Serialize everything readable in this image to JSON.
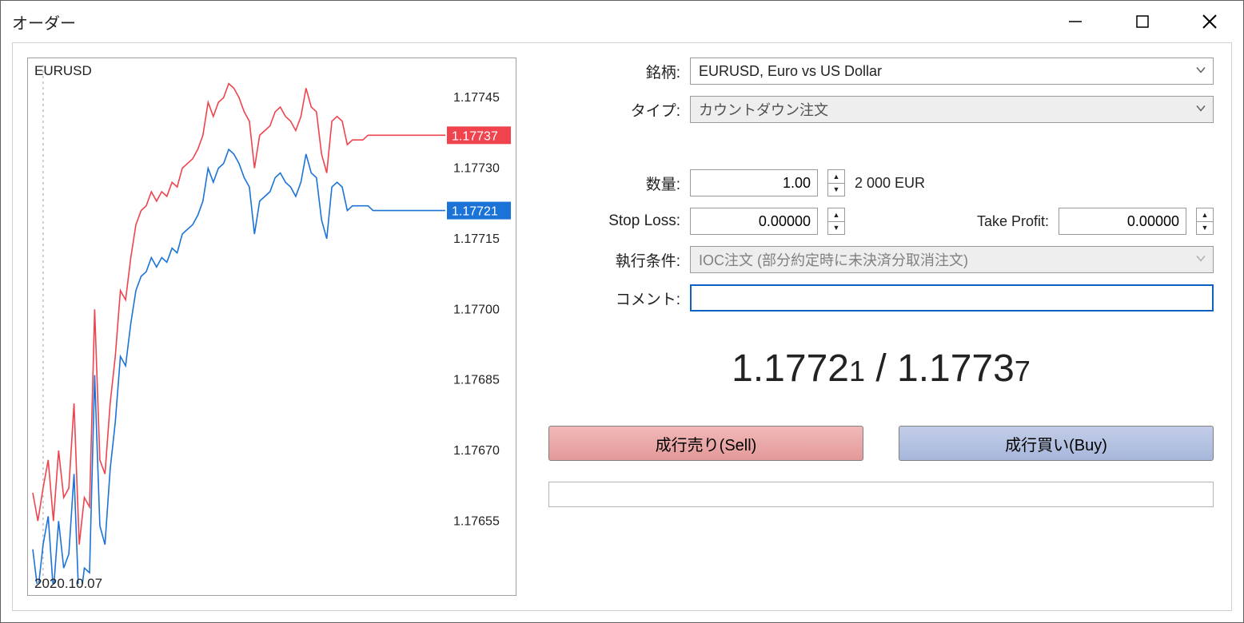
{
  "window": {
    "title": "オーダー"
  },
  "chart": {
    "symbol": "EURUSD",
    "date_label": "2020.10.07",
    "ask_tag": "1.17737",
    "bid_tag": "1.17721",
    "yticks": [
      "1.17745",
      "1.17730",
      "1.17715",
      "1.17700",
      "1.17685",
      "1.17670",
      "1.17655"
    ]
  },
  "form": {
    "symbol_label": "銘柄:",
    "symbol_value": "EURUSD, Euro vs US Dollar",
    "type_label": "タイプ:",
    "type_value": "カウントダウン注文",
    "volume_label": "数量:",
    "volume_value": "1.00",
    "volume_units": "2 000 EUR",
    "sl_label": "Stop Loss:",
    "sl_value": "0.00000",
    "tp_label": "Take Profit:",
    "tp_value": "0.00000",
    "fill_label": "執行条件:",
    "fill_value": "IOC注文 (部分約定時に未決済分取消注文)",
    "comment_label": "コメント:",
    "comment_value": ""
  },
  "quote": {
    "bid_main": "1.1772",
    "bid_last": "1",
    "sep": " / ",
    "ask_main": "1.1773",
    "ask_last": "7"
  },
  "buttons": {
    "sell": "成行売り(Sell)",
    "buy": "成行買い(Buy)"
  },
  "chart_data": {
    "type": "line",
    "x": [
      0,
      1,
      2,
      3,
      4,
      5,
      6,
      7,
      8,
      9,
      10,
      11,
      12,
      13,
      14,
      15,
      16,
      17,
      18,
      19,
      20,
      21,
      22,
      23,
      24,
      25,
      26,
      27,
      28,
      29,
      30,
      31,
      32,
      33,
      34,
      35,
      36,
      37,
      38,
      39,
      40,
      41,
      42,
      43,
      44,
      45,
      46,
      47,
      48,
      49,
      50,
      51,
      52,
      53,
      54,
      55,
      56,
      57,
      58,
      59,
      60,
      61,
      62,
      63,
      64,
      65,
      66,
      67,
      68,
      69,
      70,
      71,
      72,
      73,
      74,
      75,
      76,
      77,
      78,
      79,
      80
    ],
    "series": [
      {
        "name": "ask",
        "color": "#ef434e",
        "values": [
          1.17661,
          1.17655,
          1.17662,
          1.17668,
          1.17655,
          1.1767,
          1.1766,
          1.17662,
          1.1768,
          1.1765,
          1.1766,
          1.17658,
          1.177,
          1.17668,
          1.17665,
          1.1768,
          1.1769,
          1.17704,
          1.17702,
          1.17711,
          1.17718,
          1.17721,
          1.17722,
          1.17725,
          1.17723,
          1.17725,
          1.17724,
          1.17727,
          1.17726,
          1.1773,
          1.17731,
          1.17732,
          1.17734,
          1.17737,
          1.17744,
          1.17741,
          1.17744,
          1.17745,
          1.17748,
          1.17747,
          1.17745,
          1.17742,
          1.1774,
          1.1773,
          1.17737,
          1.17738,
          1.17739,
          1.17742,
          1.17743,
          1.17741,
          1.1774,
          1.17738,
          1.17741,
          1.17747,
          1.17743,
          1.17742,
          1.17733,
          1.17729,
          1.1774,
          1.17741,
          1.1774,
          1.17735,
          1.17736,
          1.17736,
          1.17736,
          1.17737,
          1.17737,
          1.17737,
          1.17737,
          1.17737,
          1.17737,
          1.17737,
          1.17737,
          1.17737,
          1.17737,
          1.17737,
          1.17737,
          1.17737,
          1.17737,
          1.17737,
          1.17737
        ]
      },
      {
        "name": "bid",
        "color": "#1b73d8",
        "values": [
          1.17649,
          1.1764,
          1.1765,
          1.17656,
          1.1764,
          1.17655,
          1.17645,
          1.17648,
          1.17665,
          1.17636,
          1.17645,
          1.17644,
          1.17686,
          1.17654,
          1.1765,
          1.17666,
          1.17676,
          1.1769,
          1.17688,
          1.17697,
          1.17704,
          1.17707,
          1.17708,
          1.17711,
          1.17709,
          1.17711,
          1.1771,
          1.17713,
          1.17712,
          1.17716,
          1.17717,
          1.17718,
          1.1772,
          1.17723,
          1.1773,
          1.17727,
          1.1773,
          1.17731,
          1.17734,
          1.17733,
          1.17731,
          1.17728,
          1.17726,
          1.17716,
          1.17723,
          1.17724,
          1.17725,
          1.17728,
          1.17729,
          1.17727,
          1.17726,
          1.17724,
          1.17727,
          1.17733,
          1.17729,
          1.17728,
          1.17719,
          1.17715,
          1.17726,
          1.17727,
          1.17726,
          1.17721,
          1.17722,
          1.17722,
          1.17722,
          1.17722,
          1.17721,
          1.17721,
          1.17721,
          1.17721,
          1.17721,
          1.17721,
          1.17721,
          1.17721,
          1.17721,
          1.17721,
          1.17721,
          1.17721,
          1.17721,
          1.17721,
          1.17721
        ]
      }
    ],
    "ylim": [
      1.17643,
      1.17752
    ],
    "levels": {
      "ask": 1.17737,
      "bid": 1.17721
    }
  }
}
